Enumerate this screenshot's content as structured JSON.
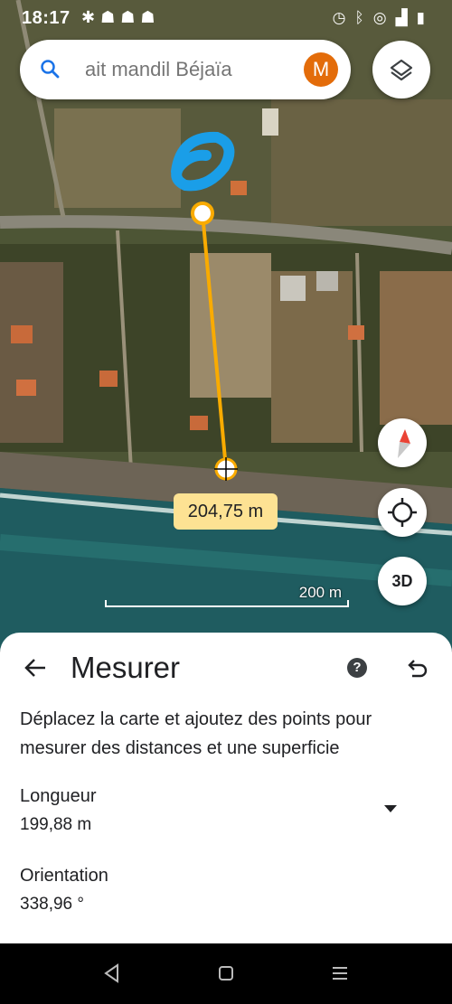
{
  "status_bar": {
    "time": "18:17",
    "left_icons": [
      "settings-icon",
      "snapchat-icon",
      "snapchat-icon",
      "snapchat-icon"
    ],
    "right_icons": [
      "alarm-icon",
      "bluetooth-icon",
      "hotspot-icon",
      "signal-icon",
      "battery-icon"
    ]
  },
  "search": {
    "query": "ait mandil Béjaïa",
    "avatar_letter": "M",
    "avatar_color": "#e36c0a"
  },
  "map": {
    "distance_label": "204,75 m",
    "scale_label": "200 m",
    "button_3d_label": "3D",
    "measure_line_color": "#f9ab00",
    "annotation_color": "#1a9ee8"
  },
  "sheet": {
    "title": "Mesurer",
    "description": "Déplacez la carte et ajoutez des points pour mesurer des distances et une superficie",
    "length_label": "Longueur",
    "length_value": "199,88 m",
    "orientation_label": "Orientation",
    "orientation_value": "338,96 °"
  },
  "nav_bar": {
    "buttons": [
      "back-nav-icon",
      "home-nav-icon",
      "recents-nav-icon"
    ]
  }
}
